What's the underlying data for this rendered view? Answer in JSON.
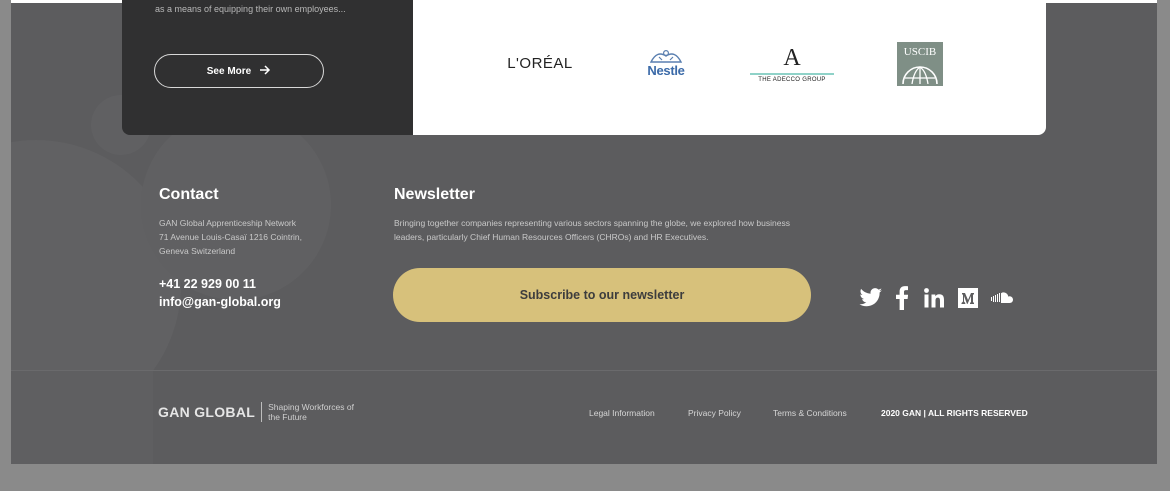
{
  "card": {
    "description": "as a means of equipping their own employees...",
    "see_more_label": "See More",
    "logos": {
      "loreal": "L'ORÉAL",
      "nestle": "Nestle",
      "adecco": "THE ADECCO GROUP",
      "uscib": "USCIB"
    }
  },
  "contact": {
    "title": "Contact",
    "address_line1": "GAN Global Apprenticeship Network",
    "address_line2": "71 Avenue Louis-Casaï  1216 Cointrin,",
    "address_line3": "Geneva Switzerland",
    "phone": "+41 22 929 00 11",
    "email": "info@gan-global.org"
  },
  "newsletter": {
    "title": "Newsletter",
    "description": "Bringing together companies representing various sectors spanning the globe, we explored how business leaders, particularly Chief Human Resources Officers (CHROs) and HR Executives.",
    "subscribe_label": "Subscribe to our newsletter"
  },
  "socials": [
    "twitter-icon",
    "facebook-icon",
    "linkedin-icon",
    "medium-icon",
    "soundcloud-icon"
  ],
  "footer": {
    "brand_name": "GAN GLOBAL",
    "brand_tagline": "Shaping Workforces of the Future",
    "legal_info": "Legal Information",
    "privacy": "Privacy Policy",
    "terms": "Terms & Conditions",
    "rights": "2020 GAN | ALL RIGHTS RESERVED"
  },
  "colors": {
    "footer_bg": "#5c5c5e",
    "card_dark": "#303031",
    "subscribe_bg": "#d7c17b"
  }
}
